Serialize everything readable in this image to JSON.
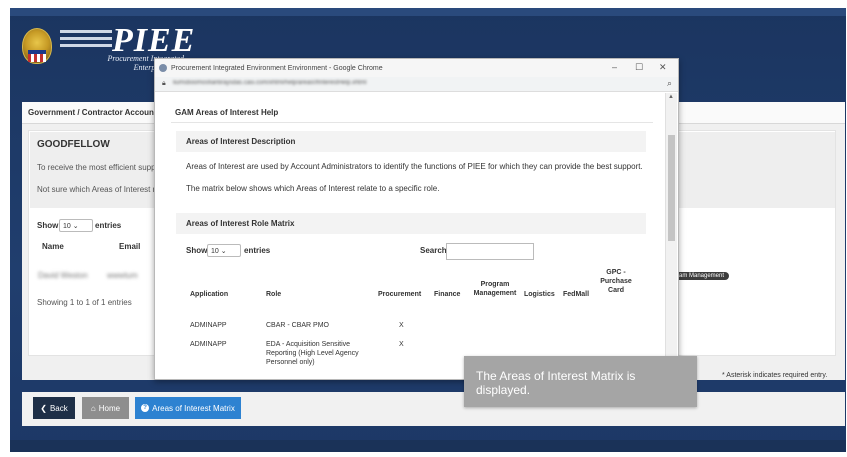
{
  "logo": {
    "title": "PIEE",
    "subtitle_line1": "Procurement Integrated",
    "subtitle_line2": "Enterprise Envi"
  },
  "background_page": {
    "header": "Government / Contractor Account A",
    "user_name": "GOODFELLOW",
    "line1": "To receive the most efficient suppo",
    "line2": "Not sure which Areas of Interest re",
    "show_label": "Show",
    "show_value": "10",
    "entries_label": "entries",
    "columns": [
      "Name",
      "Email"
    ],
    "row_name_blurred": "David Weston",
    "row_email_blurred": "wwwtum",
    "showing": "Showing 1 to 1 of 1 entries",
    "badge": "am Management",
    "asterisk_note": "* Asterisk indicates required entry."
  },
  "buttons": {
    "back": "Back",
    "home": "Home",
    "matrix": "Areas of Interest Matrix"
  },
  "popup": {
    "window_title": "Procurement Integrated Environment Environment - Google Chrome",
    "url_blurred": "liumsboomosfiantiraysdas.casi.com/xhtml/help/areas0fInterestHelp.xhtml",
    "modal_title": "GAM Areas of Interest Help",
    "section1_title": "Areas of Interest Description",
    "desc1": "Areas of Interest are used by Account Administrators to identify the functions of PIEE for which they can provide the best support.",
    "desc2": "The matrix below shows which Areas of Interest relate to a specific role.",
    "section2_title": "Areas of Interest Role Matrix",
    "show_label": "Show",
    "show_value": "10",
    "entries_label": "entries",
    "search_label": "Search:",
    "search_value": "",
    "table": {
      "headers": {
        "application": "Application",
        "role": "Role",
        "procurement": "Procurement",
        "finance": "Finance",
        "program_management": "Program Management",
        "logistics": "Logistics",
        "fedmall": "FedMall",
        "gpc": "GPC - Purchase Card"
      },
      "rows": [
        {
          "application": "ADMINAPP",
          "role": "CBAR - CBAR PMO",
          "procurement": "X"
        },
        {
          "application": "ADMINAPP",
          "role": "EDA - Acquisition Sensitive Reporting (High Level Agency Personnel only)",
          "procurement": "X"
        }
      ]
    }
  },
  "caption": "The Areas of Interest Matrix is displayed."
}
